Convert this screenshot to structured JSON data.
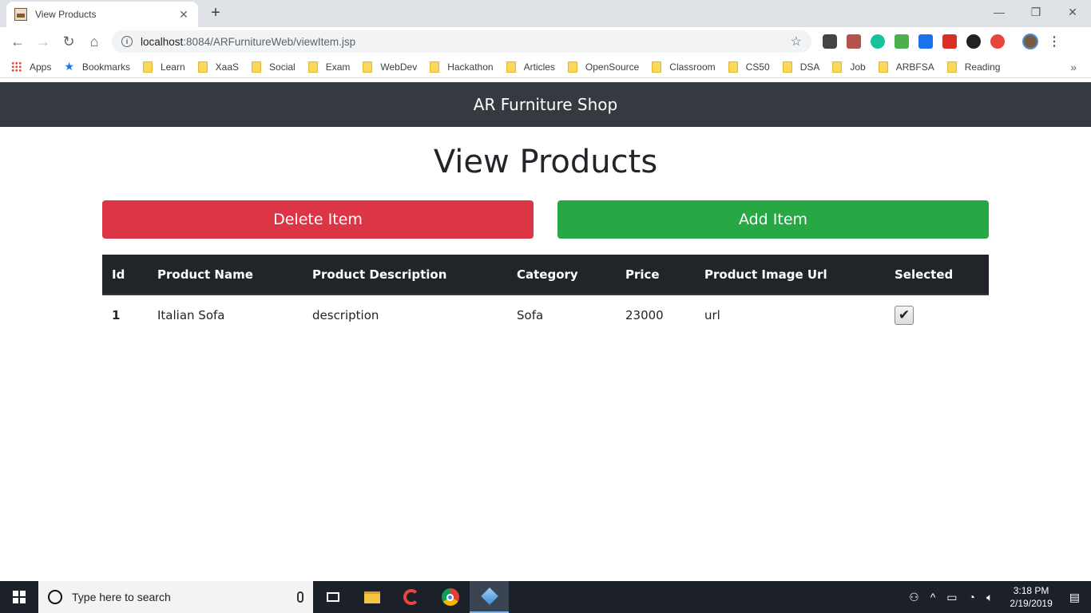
{
  "browser": {
    "tab_title": "View Products",
    "url_host": "localhost",
    "url_rest": ":8084/ARFurnitureWeb/viewItem.jsp",
    "bookmarks": [
      "Apps",
      "Bookmarks",
      "Learn",
      "XaaS",
      "Social",
      "Exam",
      "WebDev",
      "Hackathon",
      "Articles",
      "OpenSource",
      "Classroom",
      "CS50",
      "DSA",
      "Job",
      "ARBFSA",
      "Reading"
    ]
  },
  "navbar": {
    "brand": "AR Furniture Shop"
  },
  "page": {
    "title": "View Products",
    "delete_label": "Delete Item",
    "add_label": "Add Item"
  },
  "table": {
    "headers": [
      "Id",
      "Product Name",
      "Product Description",
      "Category",
      "Price",
      "Product Image Url",
      "Selected"
    ],
    "rows": [
      {
        "id": "1",
        "name": "Italian Sofa",
        "description": "description",
        "category": "Sofa",
        "price": "23000",
        "image_url": "url",
        "selected": true
      }
    ]
  },
  "taskbar": {
    "search_placeholder": "Type here to search",
    "time": "3:18 PM",
    "date": "2/19/2019"
  },
  "colors": {
    "navbar": "#343a40",
    "danger": "#dc3545",
    "success": "#28a745",
    "table_header": "#212529"
  }
}
